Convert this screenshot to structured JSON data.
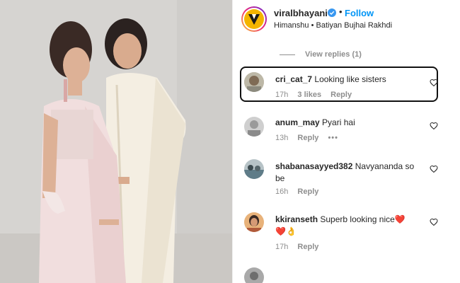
{
  "header": {
    "username": "viralbhayani",
    "separator": "•",
    "follow_label": "Follow",
    "subtitle": "Himanshu • Batiyan Bujhai Rakhdi"
  },
  "view_replies": "View replies (1)",
  "comments": [
    {
      "username": "cri_cat_7",
      "text": "Looking like sisters",
      "time": "17h",
      "likes": "3 likes",
      "reply": "Reply"
    },
    {
      "username": "anum_may",
      "text": "Pyari hai",
      "time": "13h",
      "reply": "Reply",
      "more": "•••"
    },
    {
      "username": "shabanasayyed382",
      "text": "Navyananda so be",
      "time": "16h",
      "reply": "Reply"
    },
    {
      "username": "kkiranseth",
      "text": "Superb looking nice❤️",
      "text2": "❤️👌",
      "time": "17h",
      "reply": "Reply"
    }
  ],
  "colors": {
    "link_blue": "#0095f6",
    "muted": "#8e8e8e",
    "text": "#262626",
    "heart_red": "#ed4956"
  },
  "icons": [
    "verified-badge-icon",
    "heart-outline-icon",
    "brand-logo-icon"
  ]
}
